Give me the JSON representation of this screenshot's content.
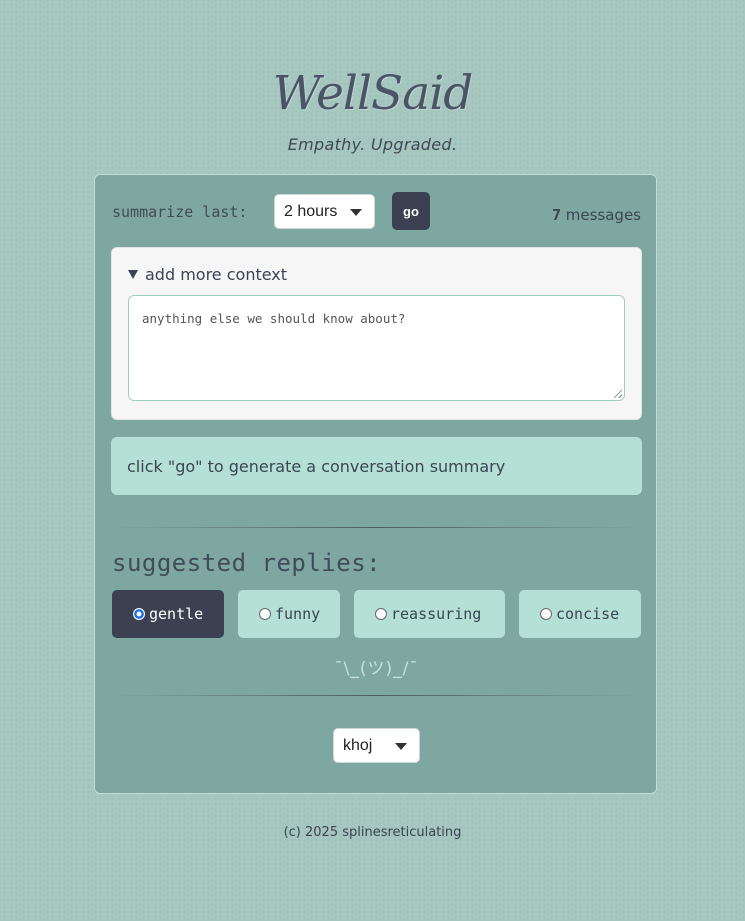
{
  "header": {
    "logo_text": "WellSaid",
    "tagline": "Empathy. Upgraded."
  },
  "summarize": {
    "label": "summarize last:",
    "time_selected": "2 hours",
    "go_label": "go",
    "message_count": "7",
    "message_suffix": "messages"
  },
  "context": {
    "summary_label": "add more context",
    "placeholder": "anything else we should know about?"
  },
  "status": {
    "text": "click \"go\" to generate a conversation summary"
  },
  "replies": {
    "heading": "suggested replies:",
    "tones": [
      {
        "label": "gentle",
        "selected": true
      },
      {
        "label": "funny",
        "selected": false
      },
      {
        "label": "reassuring",
        "selected": false
      },
      {
        "label": "concise",
        "selected": false
      }
    ],
    "empty_text": "¯\\_(ツ)_/¯"
  },
  "model": {
    "selected": "khoj"
  },
  "footer": {
    "text": "(c) 2025 splinesreticulating"
  },
  "colors": {
    "background": "#a5c6bf",
    "card": "#7fa7a2",
    "accent_light": "#b5e0d5",
    "accent_dark": "#3b4150",
    "radio_selected": "#1a73e8"
  }
}
